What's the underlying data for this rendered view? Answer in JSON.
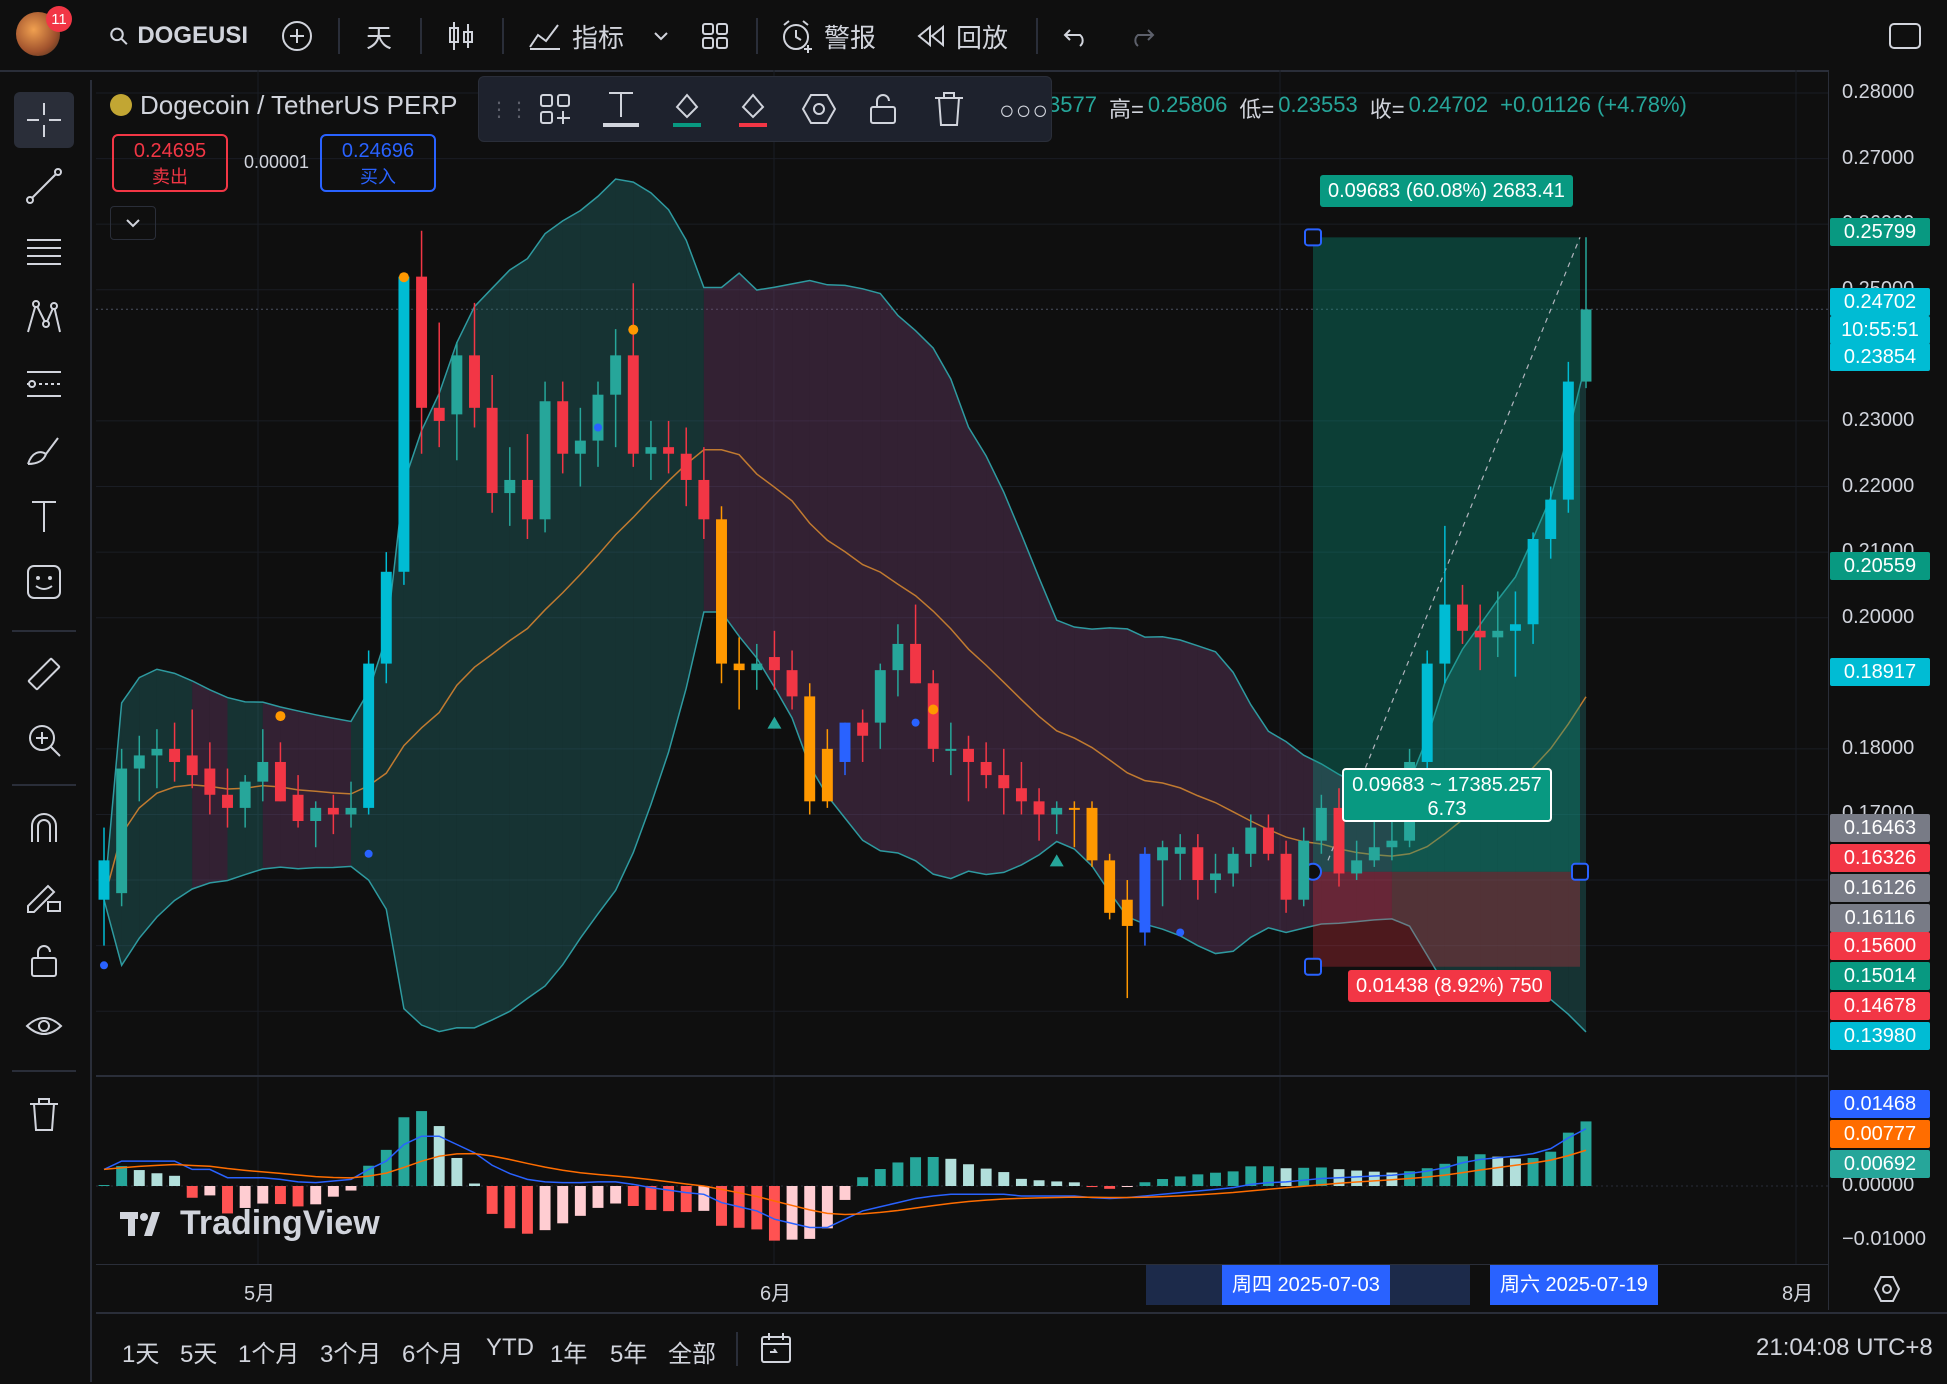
{
  "topbar": {
    "avatar_badge": "11",
    "symbol": "DOGEUSI",
    "interval": "天",
    "indicators_label": "指标",
    "alerts_label": "警报",
    "replay_label": "回放"
  },
  "legend": {
    "title": "Dogecoin / TetherUS PERP",
    "ohlc_text": "3577",
    "high_label": "高=",
    "high_value": "0.25806",
    "low_label": "低=",
    "low_value": "0.23553",
    "close_label": "收=",
    "close_value": "0.24702",
    "change": "+0.01126 (+4.78%)",
    "sell_price": "0.24695",
    "sell_label": "卖出",
    "spread": "0.00001",
    "buy_price": "0.24696",
    "buy_label": "买入"
  },
  "price_axis": {
    "ticks": [
      "0.28000",
      "0.27000",
      "0.26000",
      "0.25000",
      "0.23000",
      "0.22000",
      "0.21000",
      "0.20000",
      "0.18000",
      "0.17000"
    ],
    "tags": [
      {
        "text": "0.25799",
        "bg": "#089981"
      },
      {
        "text": "0.24702",
        "bg": "#00bcd4"
      },
      {
        "text": "10:55:51",
        "bg": "#00bcd4"
      },
      {
        "text": "0.23854",
        "bg": "#00bcd4"
      },
      {
        "text": "0.20559",
        "bg": "#089981"
      },
      {
        "text": "0.18917",
        "bg": "#00bcd4"
      },
      {
        "text": "0.16463",
        "bg": "#787b86"
      },
      {
        "text": "0.16326",
        "bg": "#f23645"
      },
      {
        "text": "0.16126",
        "bg": "#787b86"
      },
      {
        "text": "0.16116",
        "bg": "#787b86"
      },
      {
        "text": "0.15600",
        "bg": "#f23645"
      },
      {
        "text": "0.15014",
        "bg": "#089981"
      },
      {
        "text": "0.14678",
        "bg": "#f23645"
      },
      {
        "text": "0.13980",
        "bg": "#00bcd4"
      }
    ]
  },
  "macd_axis": {
    "ticks": [
      "0.00000",
      "−0.01000"
    ],
    "tags": [
      {
        "text": "0.01468",
        "bg": "#2962ff"
      },
      {
        "text": "0.00777",
        "bg": "#ff6d00"
      },
      {
        "text": "0.00692",
        "bg": "#26a69a"
      }
    ]
  },
  "position_tool": {
    "target_label": "0.09683 (60.08%) 2683.41",
    "stop_label": "0.01438 (8.92%) 750",
    "center_label_line1": "0.09683 ~ 17385.257",
    "center_label_line2": "6.73"
  },
  "time_axis": {
    "labels": [
      "5月",
      "6月",
      "8月"
    ],
    "range_start": "周四 2025-07-03",
    "range_end": "周六 2025-07-19"
  },
  "bottombar": {
    "ranges": [
      "1天",
      "5天",
      "1个月",
      "3个月",
      "6个月",
      "YTD",
      "1年",
      "5年",
      "全部"
    ],
    "clock": "21:04:08 UTC+8"
  },
  "watermark": "TradingView",
  "colors": {
    "up": "#26a69a",
    "down": "#f23645",
    "accent": "#2962ff",
    "background": "#0f0f0f"
  },
  "chart_data": {
    "type": "candlestick",
    "symbol": "DOGEUSDT.P",
    "ylim": [
      0.13,
      0.285
    ],
    "candles": [
      {
        "o": 0.163,
        "h": 0.168,
        "l": 0.15,
        "c": 0.157
      },
      {
        "o": 0.158,
        "h": 0.18,
        "l": 0.156,
        "c": 0.177
      },
      {
        "o": 0.177,
        "h": 0.182,
        "l": 0.172,
        "c": 0.179
      },
      {
        "o": 0.179,
        "h": 0.183,
        "l": 0.174,
        "c": 0.18
      },
      {
        "o": 0.18,
        "h": 0.184,
        "l": 0.175,
        "c": 0.178
      },
      {
        "o": 0.179,
        "h": 0.186,
        "l": 0.174,
        "c": 0.176
      },
      {
        "o": 0.177,
        "h": 0.181,
        "l": 0.17,
        "c": 0.173
      },
      {
        "o": 0.173,
        "h": 0.177,
        "l": 0.168,
        "c": 0.171
      },
      {
        "o": 0.171,
        "h": 0.176,
        "l": 0.168,
        "c": 0.175
      },
      {
        "o": 0.175,
        "h": 0.183,
        "l": 0.172,
        "c": 0.178
      },
      {
        "o": 0.178,
        "h": 0.181,
        "l": 0.172,
        "c": 0.172
      },
      {
        "o": 0.173,
        "h": 0.176,
        "l": 0.168,
        "c": 0.169
      },
      {
        "o": 0.169,
        "h": 0.172,
        "l": 0.165,
        "c": 0.171
      },
      {
        "o": 0.171,
        "h": 0.173,
        "l": 0.167,
        "c": 0.17
      },
      {
        "o": 0.17,
        "h": 0.175,
        "l": 0.168,
        "c": 0.171
      },
      {
        "o": 0.171,
        "h": 0.195,
        "l": 0.17,
        "c": 0.193
      },
      {
        "o": 0.193,
        "h": 0.21,
        "l": 0.19,
        "c": 0.207
      },
      {
        "o": 0.207,
        "h": 0.252,
        "l": 0.205,
        "c": 0.252
      },
      {
        "o": 0.252,
        "h": 0.259,
        "l": 0.225,
        "c": 0.232
      },
      {
        "o": 0.232,
        "h": 0.245,
        "l": 0.226,
        "c": 0.23
      },
      {
        "o": 0.231,
        "h": 0.242,
        "l": 0.224,
        "c": 0.24
      },
      {
        "o": 0.24,
        "h": 0.248,
        "l": 0.229,
        "c": 0.232
      },
      {
        "o": 0.232,
        "h": 0.237,
        "l": 0.216,
        "c": 0.219
      },
      {
        "o": 0.219,
        "h": 0.226,
        "l": 0.214,
        "c": 0.221
      },
      {
        "o": 0.221,
        "h": 0.228,
        "l": 0.212,
        "c": 0.215
      },
      {
        "o": 0.215,
        "h": 0.236,
        "l": 0.213,
        "c": 0.233
      },
      {
        "o": 0.233,
        "h": 0.236,
        "l": 0.222,
        "c": 0.225
      },
      {
        "o": 0.225,
        "h": 0.232,
        "l": 0.22,
        "c": 0.227
      },
      {
        "o": 0.227,
        "h": 0.236,
        "l": 0.223,
        "c": 0.234
      },
      {
        "o": 0.234,
        "h": 0.244,
        "l": 0.226,
        "c": 0.24
      },
      {
        "o": 0.24,
        "h": 0.251,
        "l": 0.223,
        "c": 0.225
      },
      {
        "o": 0.225,
        "h": 0.23,
        "l": 0.221,
        "c": 0.226
      },
      {
        "o": 0.226,
        "h": 0.23,
        "l": 0.222,
        "c": 0.225
      },
      {
        "o": 0.225,
        "h": 0.229,
        "l": 0.217,
        "c": 0.221
      },
      {
        "o": 0.221,
        "h": 0.226,
        "l": 0.212,
        "c": 0.215
      },
      {
        "o": 0.215,
        "h": 0.217,
        "l": 0.19,
        "c": 0.193
      },
      {
        "o": 0.193,
        "h": 0.197,
        "l": 0.186,
        "c": 0.192
      },
      {
        "o": 0.192,
        "h": 0.196,
        "l": 0.189,
        "c": 0.193
      },
      {
        "o": 0.194,
        "h": 0.198,
        "l": 0.189,
        "c": 0.192
      },
      {
        "o": 0.192,
        "h": 0.195,
        "l": 0.186,
        "c": 0.188
      },
      {
        "o": 0.188,
        "h": 0.19,
        "l": 0.17,
        "c": 0.172
      },
      {
        "o": 0.172,
        "h": 0.183,
        "l": 0.171,
        "c": 0.18
      },
      {
        "o": 0.178,
        "h": 0.184,
        "l": 0.176,
        "c": 0.184
      },
      {
        "o": 0.184,
        "h": 0.186,
        "l": 0.178,
        "c": 0.182
      },
      {
        "o": 0.184,
        "h": 0.193,
        "l": 0.18,
        "c": 0.192
      },
      {
        "o": 0.192,
        "h": 0.199,
        "l": 0.188,
        "c": 0.196
      },
      {
        "o": 0.196,
        "h": 0.202,
        "l": 0.19,
        "c": 0.19
      },
      {
        "o": 0.19,
        "h": 0.192,
        "l": 0.178,
        "c": 0.18
      },
      {
        "o": 0.18,
        "h": 0.184,
        "l": 0.176,
        "c": 0.18
      },
      {
        "o": 0.18,
        "h": 0.182,
        "l": 0.172,
        "c": 0.178
      },
      {
        "o": 0.178,
        "h": 0.181,
        "l": 0.174,
        "c": 0.176
      },
      {
        "o": 0.176,
        "h": 0.18,
        "l": 0.17,
        "c": 0.174
      },
      {
        "o": 0.174,
        "h": 0.178,
        "l": 0.17,
        "c": 0.172
      },
      {
        "o": 0.172,
        "h": 0.174,
        "l": 0.166,
        "c": 0.17
      },
      {
        "o": 0.17,
        "h": 0.172,
        "l": 0.167,
        "c": 0.171
      },
      {
        "o": 0.171,
        "h": 0.172,
        "l": 0.165,
        "c": 0.171
      },
      {
        "o": 0.171,
        "h": 0.172,
        "l": 0.162,
        "c": 0.163
      },
      {
        "o": 0.163,
        "h": 0.164,
        "l": 0.154,
        "c": 0.155
      },
      {
        "o": 0.157,
        "h": 0.16,
        "l": 0.142,
        "c": 0.153
      },
      {
        "o": 0.152,
        "h": 0.165,
        "l": 0.15,
        "c": 0.164
      },
      {
        "o": 0.163,
        "h": 0.166,
        "l": 0.156,
        "c": 0.165
      },
      {
        "o": 0.164,
        "h": 0.167,
        "l": 0.16,
        "c": 0.165
      },
      {
        "o": 0.165,
        "h": 0.167,
        "l": 0.157,
        "c": 0.16
      },
      {
        "o": 0.16,
        "h": 0.164,
        "l": 0.158,
        "c": 0.161
      },
      {
        "o": 0.161,
        "h": 0.165,
        "l": 0.159,
        "c": 0.164
      },
      {
        "o": 0.164,
        "h": 0.17,
        "l": 0.162,
        "c": 0.168
      },
      {
        "o": 0.168,
        "h": 0.17,
        "l": 0.163,
        "c": 0.164
      },
      {
        "o": 0.164,
        "h": 0.166,
        "l": 0.155,
        "c": 0.157
      },
      {
        "o": 0.157,
        "h": 0.168,
        "l": 0.156,
        "c": 0.166
      },
      {
        "o": 0.166,
        "h": 0.173,
        "l": 0.164,
        "c": 0.171
      },
      {
        "o": 0.171,
        "h": 0.174,
        "l": 0.159,
        "c": 0.161
      },
      {
        "o": 0.161,
        "h": 0.166,
        "l": 0.16,
        "c": 0.163
      },
      {
        "o": 0.163,
        "h": 0.169,
        "l": 0.162,
        "c": 0.165
      },
      {
        "o": 0.165,
        "h": 0.172,
        "l": 0.163,
        "c": 0.166
      },
      {
        "o": 0.166,
        "h": 0.18,
        "l": 0.165,
        "c": 0.178
      },
      {
        "o": 0.178,
        "h": 0.195,
        "l": 0.177,
        "c": 0.193
      },
      {
        "o": 0.193,
        "h": 0.214,
        "l": 0.19,
        "c": 0.202
      },
      {
        "o": 0.202,
        "h": 0.205,
        "l": 0.196,
        "c": 0.198
      },
      {
        "o": 0.198,
        "h": 0.202,
        "l": 0.192,
        "c": 0.197
      },
      {
        "o": 0.197,
        "h": 0.204,
        "l": 0.194,
        "c": 0.198
      },
      {
        "o": 0.198,
        "h": 0.204,
        "l": 0.191,
        "c": 0.199
      },
      {
        "o": 0.199,
        "h": 0.213,
        "l": 0.196,
        "c": 0.212
      },
      {
        "o": 0.212,
        "h": 0.22,
        "l": 0.209,
        "c": 0.218
      },
      {
        "o": 0.218,
        "h": 0.239,
        "l": 0.216,
        "c": 0.236
      },
      {
        "o": 0.236,
        "h": 0.258,
        "l": 0.235,
        "c": 0.247
      }
    ],
    "macd": [
      0.002,
      0.003,
      0.003,
      0.003,
      0.003,
      0.002,
      0.002,
      0.001,
      0.001,
      0.001,
      0.0008,
      0.0005,
      0.0004,
      0.0006,
      0.0008,
      0.002,
      0.003,
      0.005,
      0.006,
      0.006,
      0.005,
      0.004,
      0.0025,
      0.0015,
      0.0008,
      0.0005,
      0.0004,
      0.0004,
      0.0005,
      0.0005,
      0.0002,
      -0.0002,
      -0.0005,
      -0.0008,
      -0.001,
      -0.002,
      -0.0025,
      -0.003,
      -0.004,
      -0.0045,
      -0.005,
      -0.005,
      -0.004,
      -0.003,
      -0.0025,
      -0.002,
      -0.0015,
      -0.0012,
      -0.001,
      -0.001,
      -0.001,
      -0.001,
      -0.0012,
      -0.0012,
      -0.0012,
      -0.0012,
      -0.0014,
      -0.0015,
      -0.0014,
      -0.0012,
      -0.001,
      -0.0008,
      -0.0006,
      -0.0004,
      -0.0002,
      0.0002,
      0.0004,
      0.0005,
      0.0007,
      0.0009,
      0.001,
      0.0011,
      0.0012,
      0.0013,
      0.0015,
      0.0018,
      0.0022,
      0.0028,
      0.0032,
      0.0034,
      0.0036,
      0.0039,
      0.0045,
      0.0058,
      0.0069
    ]
  }
}
